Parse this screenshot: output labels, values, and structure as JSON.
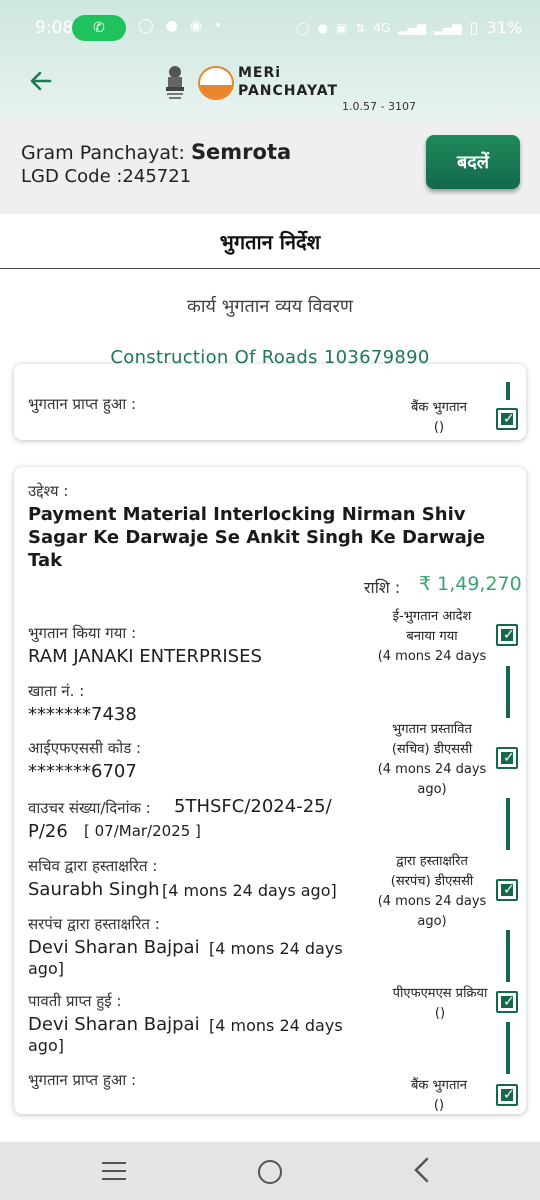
{
  "status_bar": {
    "time": "9:08",
    "network": "4G",
    "battery": "31%"
  },
  "header": {
    "app_name_line1": "MERi",
    "app_name_line2": "PANCHAYAT",
    "version": "1.0.57 - 3107"
  },
  "gp": {
    "label": "Gram Panchayat: ",
    "name": "Semrota",
    "lgd": "LGD Code :245721",
    "change_label": "बदलें"
  },
  "page": {
    "title": "भुगतान निर्देश",
    "subtitle": "कार्य भुगतान व्यय विवरण",
    "work": "Construction Of Roads  103679890"
  },
  "card_prev": {
    "received_label": "भुगतान प्राप्त हुआ :",
    "bank_step_line1": "बैंक भुगतान",
    "bank_step_line2": "()"
  },
  "card": {
    "purpose_label": "उद्देश्य :",
    "purpose": "Payment Material Interlocking Nirman Shiv Sagar Ke Darwaje Se Ankit Singh Ke Darwaje Tak",
    "amount_label": "राशि :",
    "amount": "₹ 1,49,270",
    "paid_to_label": "भुगतान किया गया :",
    "paid_to": "RAM JANAKI ENTERPRISES",
    "account_label": "खाता नं. :",
    "account": "*******7438",
    "ifsc_label": "आईएफएससी कोड :",
    "ifsc": "*******6707",
    "voucher_label": "वाउचर संख्या/दिनांक :",
    "voucher_no": "5THSFC/2024-25/",
    "voucher_no2": "P/26",
    "voucher_date": "[ 07/Mar/2025 ]",
    "secretary_label": "सचिव द्वारा हस्ताक्षरित :",
    "secretary": "Saurabh Singh",
    "secretary_time": "[4 mons 24 days ago]",
    "sarpanch_label": "सरपंच द्वारा हस्ताक्षरित :",
    "sarpanch": "Devi Sharan Bajpai",
    "sarpanch_time": "[4 mons 24 days",
    "sarpanch_time2": "ago]",
    "receipt_label": "पावती प्राप्त हुई :",
    "receipt": "Devi Sharan Bajpai",
    "receipt_time": "[4 mons 24 days",
    "receipt_time2": "ago]",
    "received_label": "भुगतान प्राप्त हुआ :"
  },
  "steps": [
    {
      "line1": "ई-भुगतान आदेश",
      "line2": "बनाया गया",
      "line3": "(4 mons 24 days",
      "line4": ""
    },
    {
      "line1": "भुगतान प्रस्तावित",
      "line2": "(सचिव) डीएससी",
      "line3": "(4 mons 24 days",
      "line4": "ago)"
    },
    {
      "line1": "द्वारा हस्ताक्षरित",
      "line2": "(सरपंच) डीएससी",
      "line3": "(4 mons 24 days",
      "line4": "ago)"
    },
    {
      "line1": "पीएफएमएस प्रक्रिया",
      "line2": "()",
      "line3": "",
      "line4": ""
    },
    {
      "line1": "बैंक भुगतान",
      "line2": "()",
      "line3": "",
      "line4": ""
    }
  ],
  "colors": {
    "primary": "#17684a",
    "accent": "#1b7a50",
    "amount": "#3aa36e"
  }
}
